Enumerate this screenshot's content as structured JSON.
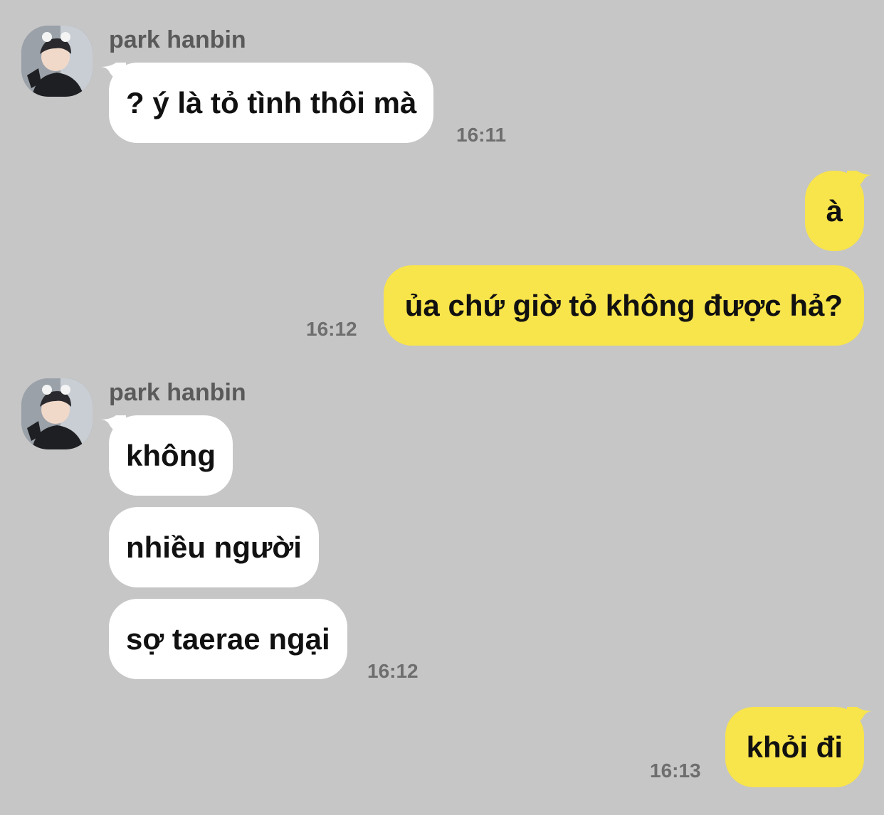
{
  "chat": {
    "contact": {
      "name": "park hanbin",
      "avatar_icon": "profile-photo-avatar"
    },
    "colors": {
      "background": "#c6c6c6",
      "incoming_bubble": "#ffffff",
      "outgoing_bubble": "#f8e44b",
      "timestamp": "#6e6e6e"
    },
    "groups": [
      {
        "direction": "incoming",
        "sender": "park hanbin",
        "messages": [
          "? ý là tỏ tình thôi mà"
        ],
        "time": "16:11"
      },
      {
        "direction": "outgoing",
        "messages": [
          "à",
          "ủa chứ giờ tỏ không được hả?"
        ],
        "time": "16:12"
      },
      {
        "direction": "incoming",
        "sender": "park hanbin",
        "messages": [
          "không",
          "nhiều người",
          "sợ taerae ngại"
        ],
        "time": "16:12"
      },
      {
        "direction": "outgoing",
        "messages": [
          "khỏi đi"
        ],
        "time": "16:13"
      }
    ]
  }
}
